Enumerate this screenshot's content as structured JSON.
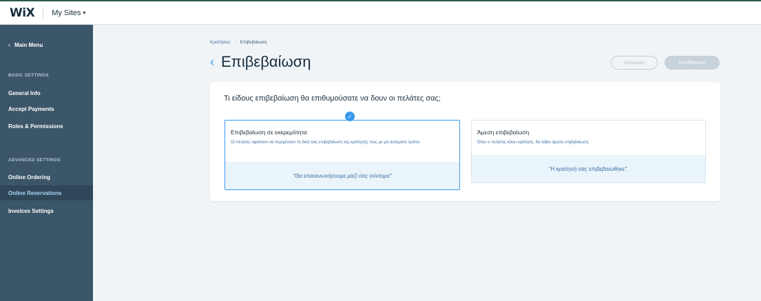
{
  "topbar": {
    "logo": "WiX",
    "my_sites": "My Sites",
    "my_sites_chevron": "⌄"
  },
  "sidebar": {
    "main_menu": "Main Menu",
    "basic_settings_title": "BASIC SETTINGS",
    "advanced_settings_title": "ADVANCED SETTINGS",
    "basic_items": [
      {
        "label": "General Info"
      },
      {
        "label": "Accept Payments"
      },
      {
        "label": "Roles & Permissions"
      }
    ],
    "advanced_items": [
      {
        "label": "Online Ordering"
      },
      {
        "label": "Online Reservations",
        "active": true
      },
      {
        "label": "Invoices Settings"
      }
    ]
  },
  "header": {
    "breadcrumb": [
      {
        "label": "Κρατήσεις"
      },
      {
        "label": "Επιβεβαίωση"
      }
    ],
    "breadcrumb_separator": "›",
    "title": "Επιβεβαίωση",
    "cancel_label": "Ακύρωση",
    "save_label": "Αποθήκευση"
  },
  "panel": {
    "question": "Τι είδους επιβεβαίωση θα επιθυμούσατε να δουν οι πελάτες σας;",
    "options": [
      {
        "title": "Επιβεβαίωση σε εκκρεμότητα",
        "description": "Οι πελάτες οφείλουν να περιμένουν τη δική σας επιβεβαίωση της κράτησής τους με μη αυτόματο τρόπο.",
        "preview": "\"Θα επικοινωνήσουμε μαζί σας σύντομα\"",
        "selected": true
      },
      {
        "title": "Άμεση επιβεβαίωση",
        "description": "Όταν ο πελάτης κάνει κράτηση, θα λάβει άμεση επιβεβαίωση.",
        "preview": "\"Η κράτησή σας επιβεβαιώθηκε\".",
        "selected": false
      }
    ]
  },
  "colors": {
    "sidebar_bg": "#3b5669",
    "sidebar_active_bg": "#2f4759",
    "accent": "#3899ec",
    "page_bg": "#f0f4f7"
  },
  "icons": {
    "back": "chevron-left-icon",
    "check": "check-icon",
    "dropdown": "chevron-down-icon"
  }
}
